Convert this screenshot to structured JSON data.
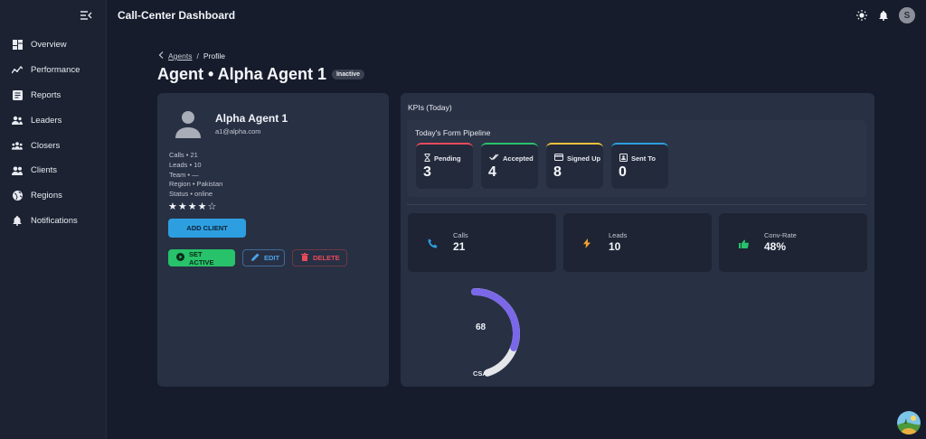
{
  "app": {
    "title": "Call-Center Dashboard"
  },
  "sidebar": {
    "items": [
      {
        "label": "Overview",
        "icon": "dashboard-icon"
      },
      {
        "label": "Performance",
        "icon": "trend-icon"
      },
      {
        "label": "Reports",
        "icon": "report-icon"
      },
      {
        "label": "Leaders",
        "icon": "group-icon"
      },
      {
        "label": "Closers",
        "icon": "groups-icon"
      },
      {
        "label": "Clients",
        "icon": "people-icon"
      },
      {
        "label": "Regions",
        "icon": "globe-icon"
      },
      {
        "label": "Notifications",
        "icon": "bell-icon"
      }
    ]
  },
  "header": {
    "avatar_initial": "S"
  },
  "breadcrumb": {
    "parent": "Agents",
    "separator": "/",
    "current": "Profile"
  },
  "page": {
    "title": "Agent • Alpha Agent 1",
    "status_badge": "Inactive"
  },
  "profile": {
    "name": "Alpha Agent 1",
    "email": "a1@alpha.com",
    "stats": [
      "Calls • 21",
      "Leads • 10",
      "Team • —",
      "Region • Pakistan",
      "Status • online"
    ],
    "rating": 4,
    "rating_max": 5,
    "stars_text": "★★★★☆",
    "add_client_label": "ADD CLIENT",
    "set_active_label": "SET ACTIVE",
    "edit_label": "EDIT",
    "delete_label": "DELETE"
  },
  "kpis": {
    "title": "KPIs (Today)",
    "pipeline": {
      "title": "Today's Form Pipeline",
      "items": [
        {
          "label": "Pending",
          "value": "3",
          "color": "#e84a5a",
          "icon": "hourglass-icon"
        },
        {
          "label": "Accepted",
          "value": "4",
          "color": "#27c26a",
          "icon": "done-all-icon"
        },
        {
          "label": "Signed Up",
          "value": "8",
          "color": "#f0c23a",
          "icon": "card-icon"
        },
        {
          "label": "Sent To",
          "value": "0",
          "color": "#2d9fe0",
          "icon": "contact-icon"
        }
      ]
    },
    "metrics": [
      {
        "label": "Calls",
        "value": "21",
        "icon": "phone-icon",
        "color": "#2d9fe0"
      },
      {
        "label": "Leads",
        "value": "10",
        "icon": "bolt-icon",
        "color": "#f0a030"
      },
      {
        "label": "Conv-Rate",
        "value": "48%",
        "icon": "thumb-up-icon",
        "color": "#27c26a"
      }
    ],
    "csat": {
      "value": "68",
      "label": "CSAT",
      "percent": 68,
      "accent": "#7b68e8",
      "track": "#e4e6ea"
    }
  }
}
